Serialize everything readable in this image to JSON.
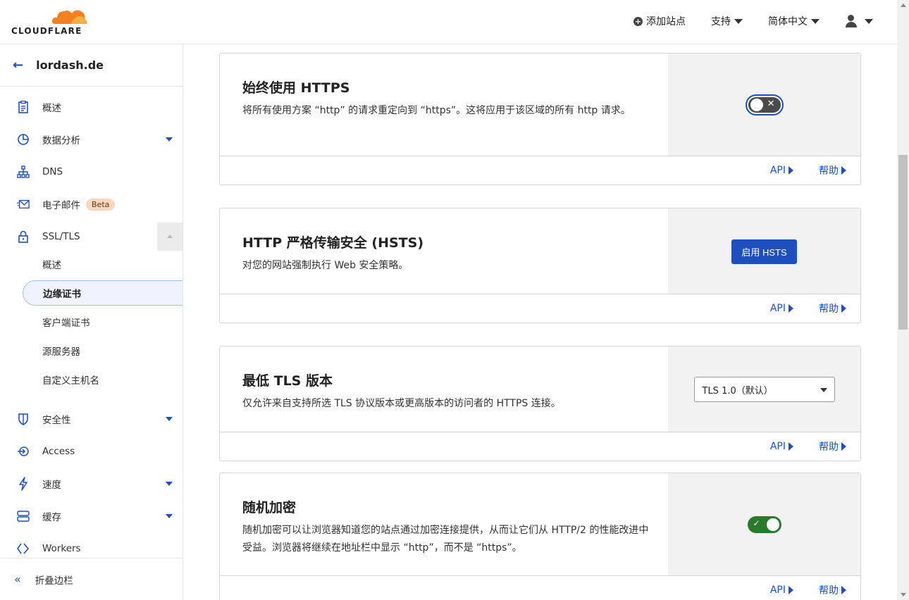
{
  "header": {
    "logo_text": "CLOUDFLARE",
    "add_site": "添加站点",
    "support": "支持",
    "language": "简体中文"
  },
  "sidebar": {
    "zone": "lordash.de",
    "items": [
      {
        "label": "概述"
      },
      {
        "label": "数据分析"
      },
      {
        "label": "DNS"
      },
      {
        "label": "电子邮件",
        "badge": "Beta"
      },
      {
        "label": "SSL/TLS"
      },
      {
        "label": "安全性"
      },
      {
        "label": "Access"
      },
      {
        "label": "速度"
      },
      {
        "label": "缓存"
      },
      {
        "label": "Workers"
      }
    ],
    "ssl_sub": [
      "概述",
      "边缘证书",
      "客户端证书",
      "源服务器",
      "自定义主机名"
    ],
    "collapse": "折叠边栏"
  },
  "cards": {
    "https": {
      "title": "始终使用 HTTPS",
      "desc": "将所有使用方案 “http” 的请求重定向到 “https”。这将应用于该区域的所有 http 请求。",
      "toggle_state": "off"
    },
    "hsts": {
      "title": "HTTP 严格传输安全 (HSTS)",
      "desc": "对您的网站强制执行 Web 安全策略。",
      "button": "启用 HSTS"
    },
    "tls": {
      "title": "最低 TLS 版本",
      "desc": "仅允许来自支持所选 TLS 协议版本或更高版本的访问者的 HTTPS 连接。",
      "selected": "TLS 1.0（默认）"
    },
    "oe": {
      "title": "随机加密",
      "desc": "随机加密可以让浏览器知道您的站点通过加密连接提供，从而让它们从 HTTP/2 的性能改进中受益。浏览器将继续在地址栏中显示 “http”，而不是 “https”。",
      "toggle_state": "on"
    },
    "api_label": "API",
    "help_label": "帮助"
  },
  "colors": {
    "accent": "#1f4fbf",
    "toggle_on": "#2b7a2b",
    "brand_orange": "#f48120"
  }
}
